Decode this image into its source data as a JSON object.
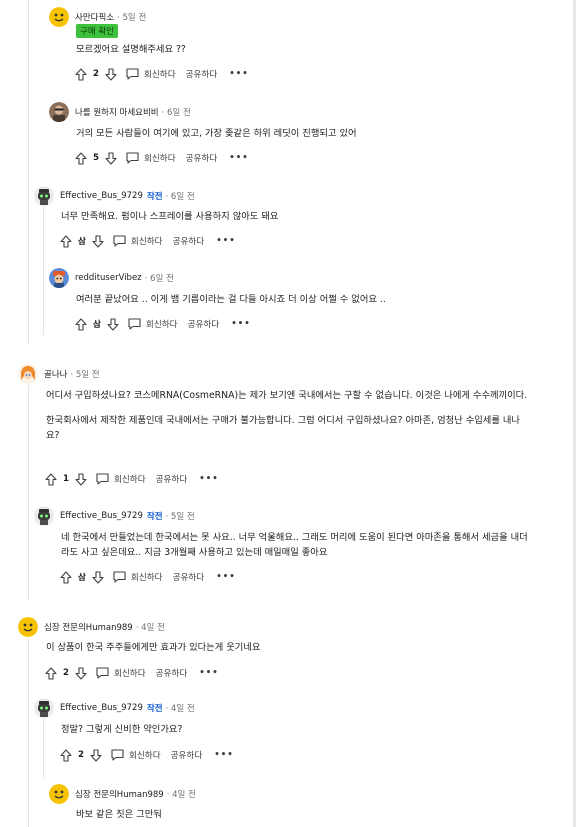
{
  "labels": {
    "reply": "회신하다",
    "share": "공유하다",
    "more": "•••",
    "op_tag": "작전"
  },
  "comments": [
    {
      "user": "사만다픽소",
      "time": "· 5일 전",
      "flair": "구매 확인",
      "paragraphs": [
        "모르겠어요 설명해주세요 ??"
      ],
      "votes": "2",
      "avatar": "yellow"
    },
    {
      "user": "나를 원하지 마세요비비",
      "time": "· 6일 전",
      "paragraphs": [
        "거의 모든 사람들이 여기에 있고, 가장 좆같은 하위 레딧이 진행되고 있어"
      ],
      "votes": "5",
      "avatar": "photo"
    },
    {
      "user": "Effective_Bus_9729",
      "time": "· 6일 전",
      "op": true,
      "paragraphs": [
        "너무 만족해요. 펌이나 스프레이를 사용하지 않아도 돼요"
      ],
      "votes": "삼",
      "avatar": "robot"
    },
    {
      "user": "reddituserVibez",
      "time": "· 6일 전",
      "paragraphs": [
        "여러분 끝났어요 .. 이게 뱀 기름이라는 걸 다들 아시죠 더 이상 어쩔 수 없어요 .."
      ],
      "votes": "삼",
      "avatar": "blue"
    },
    {
      "user": "골나나",
      "time": "· 5일 전",
      "paragraphs": [
        "어디서 구입하셨나요? 코스메RNA(CosmeRNA)는 제가 보기엔 국내에서는 구할 수 없습니다. 이것은 나에게 수수께끼이다.",
        "한국회사에서 제작한 제품인데 국내에서는 구매가 불가능합니다. 그럼 어디서 구입하셨나요? 아마존, 엄청난 수입세를 내나요?"
      ],
      "votes": "1",
      "avatar": "anime"
    },
    {
      "user": "Effective_Bus_9729",
      "time": "· 5일 전",
      "op": true,
      "paragraphs": [
        "네 한국에서 만들었는데 한국에서는 못 사요.. 너무 억울해요.. 그래도 머리에 도움이 된다면 아마존을 통해서 세금을 내더라도 사고 싶은데요.. 지금 3개월째 사용하고 있는데 매일매일 좋아요"
      ],
      "votes": "삼",
      "avatar": "robot"
    },
    {
      "user": "심장 전문의Human989",
      "time": "· 4일 전",
      "paragraphs": [
        "이 상품이 한국 주주들에게만 효과가 있다는게 웃기네요"
      ],
      "votes": "2",
      "avatar": "yellow"
    },
    {
      "user": "Effective_Bus_9729",
      "time": "· 4일 전",
      "op": true,
      "paragraphs": [
        "정말? 그렇게 신비한 약인가요?"
      ],
      "votes": "2",
      "avatar": "robot"
    },
    {
      "user": "심장 전문의Human989",
      "time": "· 4일 전",
      "paragraphs": [
        "바보 같은 짓은 그만둬"
      ],
      "avatar": "yellow"
    }
  ]
}
